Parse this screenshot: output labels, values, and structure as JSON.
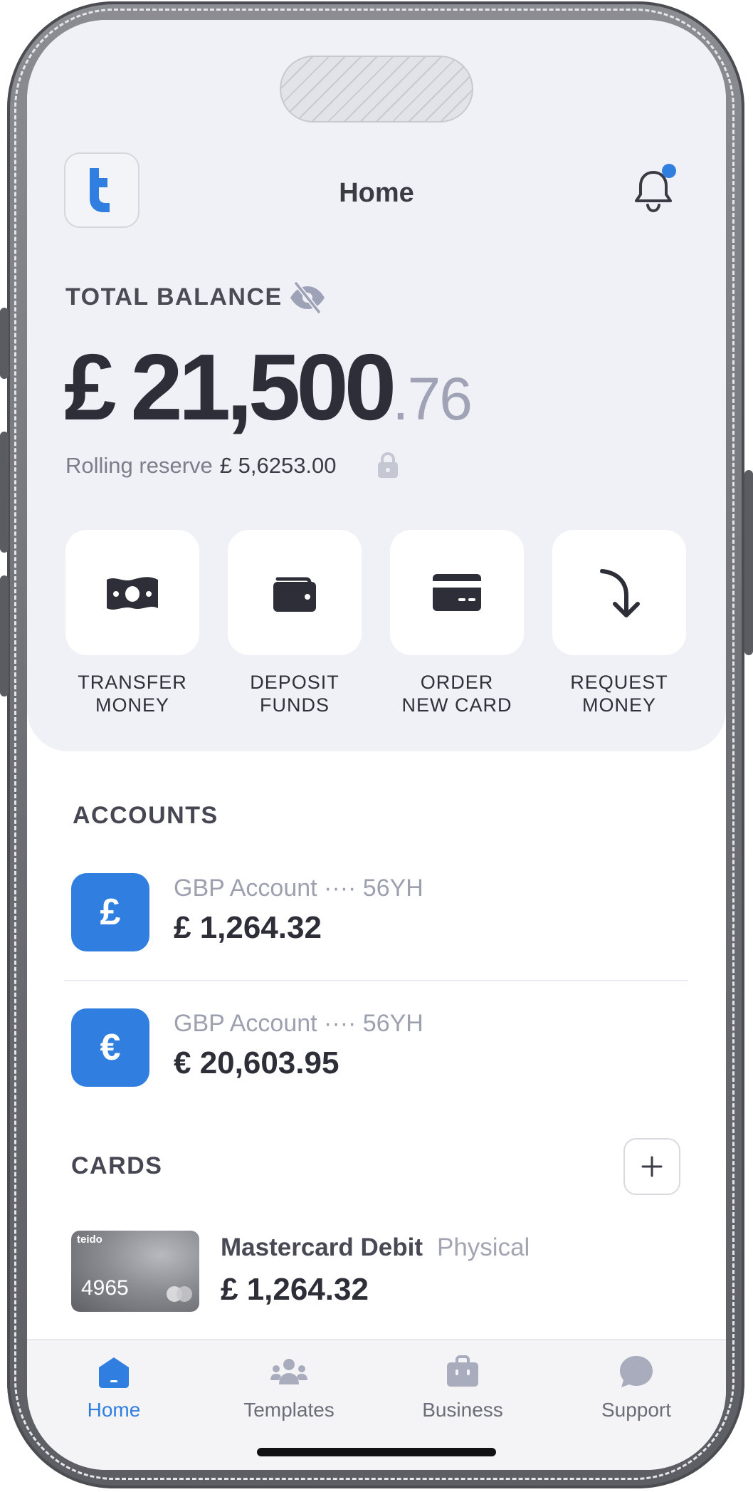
{
  "header": {
    "title": "Home",
    "logo_letter": "t"
  },
  "balance": {
    "label": "TOTAL BALANCE",
    "currency": "£",
    "integer": "21,500",
    "decimal": ".76",
    "reserve_label": "Rolling reserve",
    "reserve_value": "£ 5,6253.00"
  },
  "actions": [
    {
      "line1": "TRANSFER",
      "line2": "MONEY",
      "icon": "banknote-icon"
    },
    {
      "line1": "DEPOSIT",
      "line2": "FUNDS",
      "icon": "wallet-icon"
    },
    {
      "line1": "ORDER",
      "line2": "NEW CARD",
      "icon": "card-icon"
    },
    {
      "line1": "REQUEST",
      "line2": "MONEY",
      "icon": "arrow-down-right-icon"
    }
  ],
  "accounts": {
    "title": "ACCOUNTS",
    "items": [
      {
        "symbol": "£",
        "name": "GBP Account ···· 56YH",
        "amount": "£ 1,264.32"
      },
      {
        "symbol": "€",
        "name": "GBP Account ···· 56YH",
        "amount": "€ 20,603.95"
      }
    ]
  },
  "cards": {
    "title": "CARDS",
    "items": [
      {
        "brand": "teido",
        "last4": "4965",
        "name": "Mastercard Debit",
        "type": "Physical",
        "amount": "£ 1,264.32"
      }
    ]
  },
  "tabs": [
    {
      "label": "Home",
      "icon": "home-icon",
      "active": true
    },
    {
      "label": "Templates",
      "icon": "templates-icon",
      "active": false
    },
    {
      "label": "Business",
      "icon": "briefcase-icon",
      "active": false
    },
    {
      "label": "Support",
      "icon": "chat-icon",
      "active": false
    }
  ],
  "colors": {
    "accent": "#2f7ee0",
    "panel": "#f0f1f6",
    "text": "#2d2e38"
  }
}
